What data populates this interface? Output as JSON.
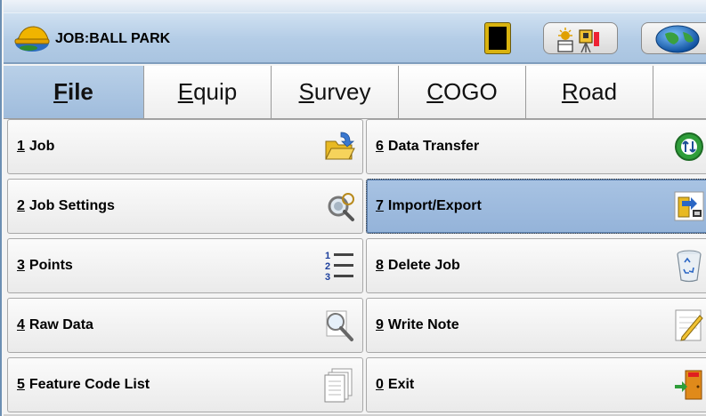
{
  "header": {
    "job_title": "JOB:BALL PARK",
    "icons": [
      "hardhat-logo-icon",
      "battery-icon",
      "survey-instrument-icon",
      "globe-icon"
    ]
  },
  "tabs": [
    {
      "prefix": "",
      "mnemonic": "F",
      "rest": "ile",
      "active": true
    },
    {
      "prefix": "",
      "mnemonic": "E",
      "rest": "quip",
      "active": false
    },
    {
      "prefix": "",
      "mnemonic": "S",
      "rest": "urvey",
      "active": false
    },
    {
      "prefix": "",
      "mnemonic": "C",
      "rest": "OGO",
      "active": false
    },
    {
      "prefix": "",
      "mnemonic": "R",
      "rest": "oad",
      "active": false
    }
  ],
  "menu": {
    "left": [
      {
        "num": "1",
        "label": "Job",
        "icon": "folder-open-icon"
      },
      {
        "num": "2",
        "label": "Job Settings",
        "icon": "job-settings-icon"
      },
      {
        "num": "3",
        "label": "Points",
        "icon": "numbered-list-icon"
      },
      {
        "num": "4",
        "label": "Raw Data",
        "icon": "magnifier-icon"
      },
      {
        "num": "5",
        "label": "Feature Code List",
        "icon": "pages-icon"
      }
    ],
    "right": [
      {
        "num": "6",
        "label": "Data Transfer",
        "icon": "data-transfer-icon"
      },
      {
        "num": "7",
        "label": "Import/Export",
        "icon": "import-export-icon",
        "selected": true
      },
      {
        "num": "8",
        "label": "Delete Job",
        "icon": "recycle-bin-icon"
      },
      {
        "num": "9",
        "label": "Write Note",
        "icon": "write-note-icon"
      },
      {
        "num": "0",
        "label": "Exit",
        "icon": "exit-door-icon"
      }
    ]
  },
  "colors": {
    "titlebar": "#b3cce6",
    "active_tab": "#a9c4e0",
    "selected_item": "#9fbadc"
  }
}
